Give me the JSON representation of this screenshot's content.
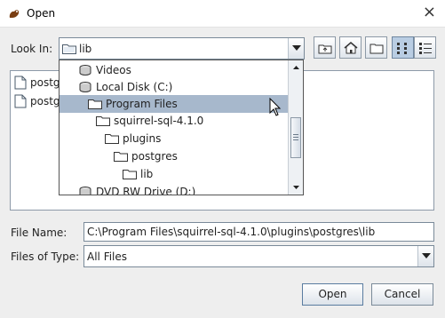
{
  "window": {
    "title": "Open",
    "icon": "squirrel-icon",
    "close": "×"
  },
  "look_in": {
    "label": "Look In:",
    "value": "lib"
  },
  "toolbar": {
    "buttons": [
      "up-one-level-icon",
      "home-icon",
      "new-folder-icon",
      "list-view-icon",
      "details-view-icon"
    ]
  },
  "file_list": {
    "items": [
      "postg",
      "postg"
    ]
  },
  "dropdown": {
    "items": [
      {
        "label": "Videos",
        "icon": "video-drive-icon"
      },
      {
        "label": "Local Disk (C:)",
        "icon": "hard-disk-icon"
      },
      {
        "label": "Program Files",
        "icon": "folder-icon",
        "selected": true
      },
      {
        "label": "squirrel-sql-4.1.0",
        "icon": "folder-icon"
      },
      {
        "label": "plugins",
        "icon": "folder-icon"
      },
      {
        "label": "postgres",
        "icon": "folder-icon"
      },
      {
        "label": "lib",
        "icon": "folder-icon"
      },
      {
        "label": "DVD RW Drive (D:)",
        "icon": "dvd-drive-icon"
      }
    ]
  },
  "file_name": {
    "label": "File Name:",
    "value": "C:\\Program Files\\squirrel-sql-4.1.0\\plugins\\postgres\\lib"
  },
  "files_of_type": {
    "label": "Files of Type:",
    "value": "All Files"
  },
  "buttons": {
    "open": "Open",
    "cancel": "Cancel"
  },
  "colors": {
    "selection": "#a7b8cc",
    "dialog_bg": "#eeeeee",
    "border": "#7a8a99"
  }
}
